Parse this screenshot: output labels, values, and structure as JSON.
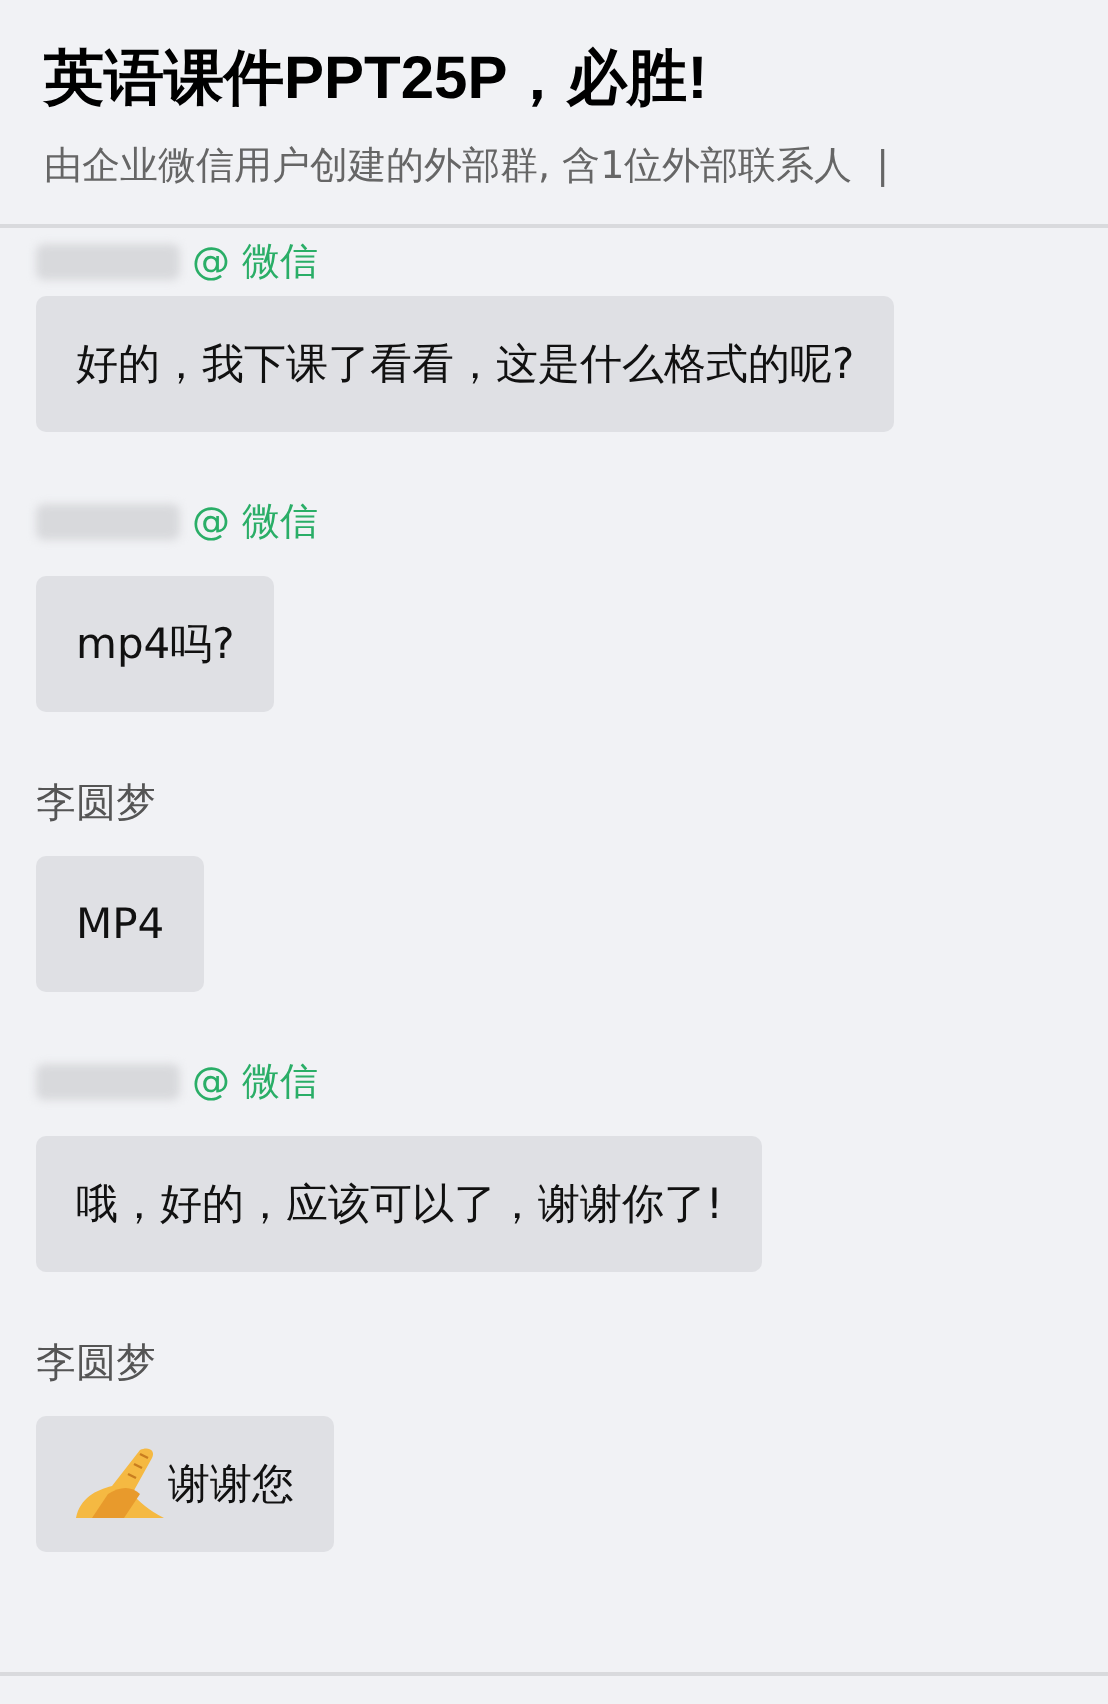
{
  "header": {
    "title": "英语课件PPT25P，必胜!",
    "subtitle": "由企业微信用户创建的外部群, 含1位外部联系人",
    "separator": "|"
  },
  "messages": [
    {
      "sender": {
        "kind": "external",
        "tag": "@ 微信"
      },
      "kind": "text",
      "text": "好的，我下课了看看，这是什么格式的呢?"
    },
    {
      "sender": {
        "kind": "external",
        "tag": "@ 微信"
      },
      "kind": "text",
      "text": "mp4吗?"
    },
    {
      "sender": {
        "kind": "member",
        "name": "李圆梦"
      },
      "kind": "text",
      "text": "MP4"
    },
    {
      "sender": {
        "kind": "external",
        "tag": "@ 微信"
      },
      "kind": "text",
      "text": "哦，好的，应该可以了，谢谢你了!"
    },
    {
      "sender": {
        "kind": "member",
        "name": "李圆梦"
      },
      "kind": "emoji_text",
      "text": "谢谢您"
    }
  ]
}
